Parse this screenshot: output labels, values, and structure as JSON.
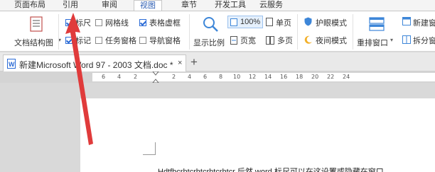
{
  "menu": {
    "tabs": [
      {
        "label": "页面布局"
      },
      {
        "label": "引用"
      },
      {
        "label": "审阅"
      },
      {
        "label": "视图"
      },
      {
        "label": "章节"
      },
      {
        "label": "开发工具"
      },
      {
        "label": "云服务"
      }
    ]
  },
  "ribbon": {
    "doc_structure": "文档结构图",
    "ruler": "标尺",
    "gridlines": "网格线",
    "table_gridlines": "表格虚框",
    "markup": "标记",
    "task_pane": "任务窗格",
    "nav_pane": "导航窗格",
    "show_scale": "显示比例",
    "zoom_100": "100%",
    "single_page": "单页",
    "page_width": "页宽",
    "multi_page": "多页",
    "eye_protect": "护眼模式",
    "night_mode": "夜间模式",
    "rearrange": "重排窗口",
    "new_window": "新建窗",
    "split_window": "拆分窗"
  },
  "tabbar": {
    "doc_title": "新建Microsoft Word 97 - 2003 文档.doc *",
    "close": "×",
    "add": "+"
  },
  "ruler": {
    "numbers": [
      "6",
      "4",
      "2",
      "2",
      "4",
      "6",
      "8",
      "10",
      "12",
      "14",
      "16",
      "18",
      "20",
      "22",
      "24"
    ]
  },
  "document": {
    "text": "Hdtfbcrhtcrhtcrhtcrhtcr 后然 word 标尺可以在这设置或隐藏在窗口"
  },
  "colors": {
    "accent": "#2b6bd6",
    "arrow": "#e03b3b"
  }
}
